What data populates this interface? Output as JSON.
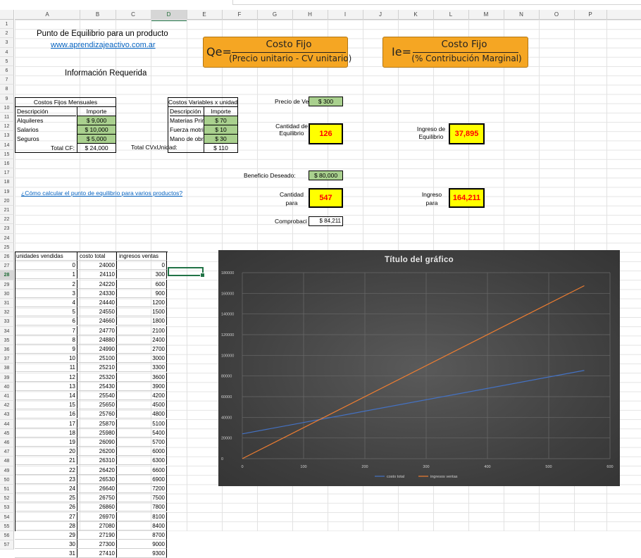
{
  "columns": [
    "A",
    "B",
    "C",
    "D",
    "E",
    "F",
    "G",
    "H",
    "I",
    "J",
    "K",
    "L",
    "M",
    "N",
    "O",
    "P"
  ],
  "selected_column": "D",
  "selected_row": "28",
  "rows": [
    "1",
    "2",
    "3",
    "4",
    "5",
    "6",
    "7",
    "8",
    "9",
    "10",
    "11",
    "12",
    "13",
    "14",
    "15",
    "16",
    "17",
    "18",
    "19",
    "20",
    "21",
    "22",
    "23",
    "24",
    "25",
    "26",
    "27",
    "28",
    "29",
    "30",
    "31",
    "32",
    "33",
    "34",
    "35",
    "36",
    "37",
    "38",
    "39",
    "40",
    "41",
    "42",
    "43",
    "44",
    "45",
    "46",
    "47",
    "48",
    "49",
    "50",
    "51",
    "52",
    "53",
    "54",
    "55",
    "56",
    "57"
  ],
  "header": {
    "title": "Punto de Equilibrio para un producto",
    "website": "www.aprendizajeactivo.com.ar",
    "info": "Información Requerida",
    "how_to_link": "¿Cómo calcular el punto de equilibrio para varios productos?"
  },
  "formula_qe": {
    "prefix": "Qe=",
    "numerator": "Costo Fijo",
    "denominator": "(Precio unitario - CV unitario)"
  },
  "formula_ie": {
    "prefix": "Ie=",
    "numerator": "Costo Fijo",
    "denominator": "(% Contribución Marginal)"
  },
  "fixed_costs": {
    "title": "Costos Fijos Mensuales",
    "col1": "Descripción",
    "col2": "Importe",
    "rows": [
      {
        "desc": "Alquileres",
        "amount": "$ 9,000"
      },
      {
        "desc": "Salarios",
        "amount": "$ 10,000"
      },
      {
        "desc": "Seguros",
        "amount": "$ 5,000"
      }
    ],
    "total_label": "Total CF:",
    "total": "$ 24,000"
  },
  "variable_costs": {
    "title": "Costos Variables x unidad",
    "col1": "Descripción",
    "col2": "Importe",
    "rows": [
      {
        "desc": "Materias Primas",
        "amount": "$ 70"
      },
      {
        "desc": "Fuerza motriz",
        "amount": "$ 10"
      },
      {
        "desc": "Mano de obra",
        "amount": "$ 30"
      }
    ],
    "total_label": "Total CVxUnidad:",
    "total": "$ 110"
  },
  "price": {
    "label": "Precio de Venta",
    "value": "$ 300"
  },
  "equilibrium_qty": {
    "label": "Cantidad de Equilibrio",
    "value": "126"
  },
  "equilibrium_income": {
    "label": "Ingreso de Equilibrio",
    "value": "37,895"
  },
  "desired_profit": {
    "label": "Beneficio Deseado:",
    "value": "$ 80,000"
  },
  "qty_for": {
    "label": "Cantidad para",
    "value": "547"
  },
  "income_for": {
    "label": "Ingreso para",
    "value": "164,211"
  },
  "check": {
    "label": "Comprobación",
    "value": "$ 84,211"
  },
  "table": {
    "headers": [
      "unidades vendidas",
      "costo total",
      "ingresos ventas"
    ],
    "rows": [
      [
        0,
        24000,
        0
      ],
      [
        1,
        24110,
        300
      ],
      [
        2,
        24220,
        600
      ],
      [
        3,
        24330,
        900
      ],
      [
        4,
        24440,
        1200
      ],
      [
        5,
        24550,
        1500
      ],
      [
        6,
        24660,
        1800
      ],
      [
        7,
        24770,
        2100
      ],
      [
        8,
        24880,
        2400
      ],
      [
        9,
        24990,
        2700
      ],
      [
        10,
        25100,
        3000
      ],
      [
        11,
        25210,
        3300
      ],
      [
        12,
        25320,
        3600
      ],
      [
        13,
        25430,
        3900
      ],
      [
        14,
        25540,
        4200
      ],
      [
        15,
        25650,
        4500
      ],
      [
        16,
        25760,
        4800
      ],
      [
        17,
        25870,
        5100
      ],
      [
        18,
        25980,
        5400
      ],
      [
        19,
        26090,
        5700
      ],
      [
        20,
        26200,
        6000
      ],
      [
        21,
        26310,
        6300
      ],
      [
        22,
        26420,
        6600
      ],
      [
        23,
        26530,
        6900
      ],
      [
        24,
        26640,
        7200
      ],
      [
        25,
        26750,
        7500
      ],
      [
        26,
        26860,
        7800
      ],
      [
        27,
        26970,
        8100
      ],
      [
        28,
        27080,
        8400
      ],
      [
        29,
        27190,
        8700
      ],
      [
        30,
        27300,
        9000
      ],
      [
        31,
        27410,
        9300
      ]
    ]
  },
  "chart_data": {
    "type": "line",
    "title": "Título del gráfico",
    "xlabel": "",
    "ylabel": "",
    "xlim": [
      0,
      600
    ],
    "ylim": [
      0,
      180000
    ],
    "x_ticks": [
      "0",
      "100",
      "200",
      "300",
      "400",
      "500",
      "600"
    ],
    "y_ticks": [
      "0",
      "20000",
      "40000",
      "60000",
      "80000",
      "100000",
      "120000",
      "140000",
      "160000",
      "180000"
    ],
    "grid": true,
    "legend": "bottom",
    "series": [
      {
        "name": "costo total",
        "color": "#4472c4",
        "x": [
          0,
          558
        ],
        "y": [
          24000,
          85380
        ]
      },
      {
        "name": "ingresos ventas",
        "color": "#ed7d31",
        "x": [
          0,
          558
        ],
        "y": [
          0,
          167400
        ]
      }
    ]
  }
}
